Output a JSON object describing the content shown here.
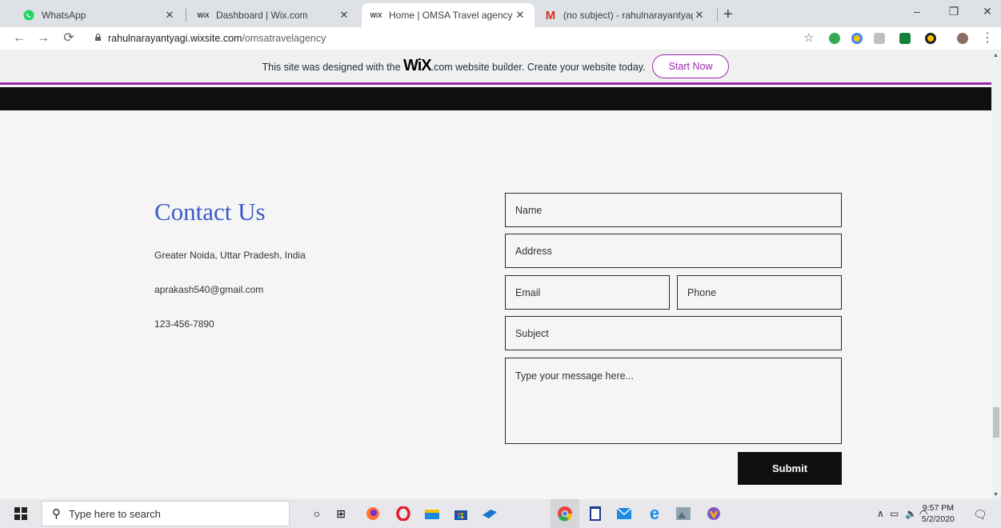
{
  "browser": {
    "tabs": [
      {
        "title": "WhatsApp",
        "favicon": "whatsapp-icon",
        "active": false
      },
      {
        "title": "Dashboard | Wix.com",
        "favicon": "wix-icon",
        "active": false
      },
      {
        "title": "Home | OMSA Travel agency",
        "favicon": "wix-icon",
        "active": true
      },
      {
        "title": "(no subject) - rahulnarayantyagi",
        "favicon": "gmail-icon",
        "active": false
      }
    ],
    "favicon_wix_text": "WiX",
    "favicon_gmail_text": "M",
    "new_tab": "+",
    "url_host": "rahulnarayantyagi.wixsite.com",
    "url_path": "/omsatravelagency"
  },
  "wix_banner": {
    "message_before": "This site was designed with the",
    "logo": "WiX",
    "message_after": ".com website builder. Create your website today.",
    "button_label": "Start Now"
  },
  "contact": {
    "title": "Contact Us",
    "address": "Greater Noida, Uttar Pradesh, India",
    "email": "aprakash540@gmail.com",
    "phone": "123-456-7890"
  },
  "form": {
    "name_placeholder": "Name",
    "address_placeholder": "Address",
    "email_placeholder": "Email",
    "phone_placeholder": "Phone",
    "subject_placeholder": "Subject",
    "message_placeholder": "Type your message here...",
    "submit_label": "Submit"
  },
  "taskbar": {
    "search_placeholder": "Type here to search",
    "time": "9:57 PM",
    "date": "5/2/2020"
  },
  "colors": {
    "accent": "#9c27b0",
    "title_blue": "#3a5bc7",
    "dark": "#0f0f0f"
  }
}
